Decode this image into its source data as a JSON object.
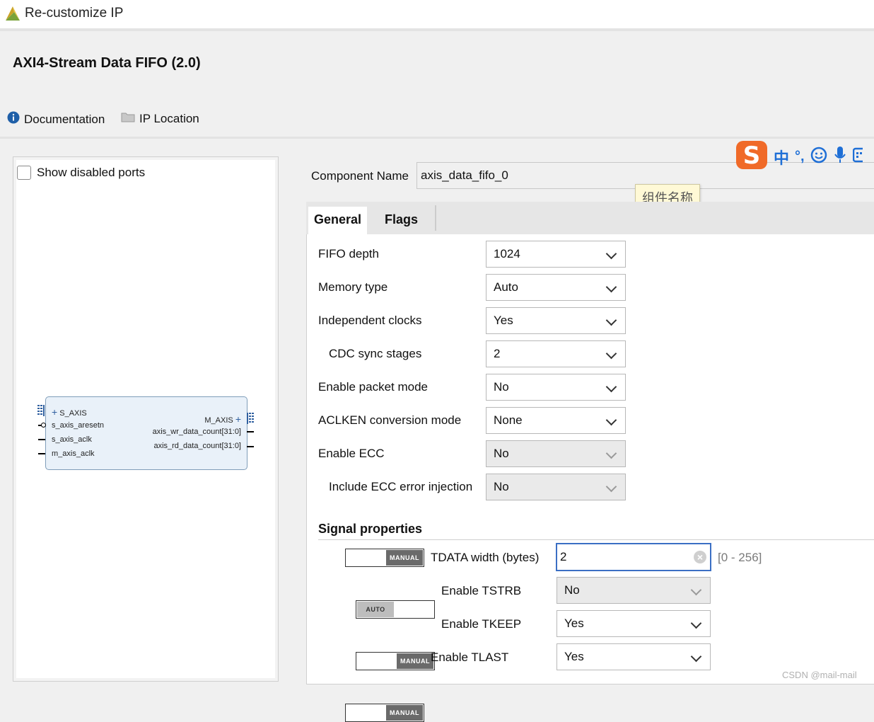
{
  "window": {
    "title": "Re-customize IP"
  },
  "ip": {
    "title": "AXI4-Stream Data FIFO (2.0)"
  },
  "toplinks": {
    "documentation": "Documentation",
    "ip_location": "IP Location"
  },
  "symbol": {
    "show_disabled_ports": "Show disabled ports",
    "left_ports": [
      "S_AXIS",
      "s_axis_aresetn",
      "s_axis_aclk",
      "m_axis_aclk"
    ],
    "right_ports": [
      "M_AXIS",
      "axis_wr_data_count[31:0]",
      "axis_rd_data_count[31:0]"
    ]
  },
  "component": {
    "label": "Component Name",
    "value": "axis_data_fifo_0"
  },
  "ime": {
    "tooltip": "组件名称",
    "lang": "中",
    "punct": "°,"
  },
  "tabs": [
    {
      "label": "General"
    },
    {
      "label": "Flags"
    }
  ],
  "general": {
    "params": [
      {
        "label": "FIFO depth",
        "value": "1024",
        "enabled": true
      },
      {
        "label": "Memory type",
        "value": "Auto",
        "enabled": true
      },
      {
        "label": "Independent clocks",
        "value": "Yes",
        "enabled": true
      },
      {
        "label": "CDC sync stages",
        "value": "2",
        "enabled": true
      },
      {
        "label": "Enable packet mode",
        "value": "No",
        "enabled": true
      },
      {
        "label": "ACLKEN conversion mode",
        "value": "None",
        "enabled": true
      },
      {
        "label": "Enable ECC",
        "value": "No",
        "enabled": false
      },
      {
        "label": "Include ECC error injection",
        "value": "No",
        "enabled": false
      }
    ],
    "signal_properties": {
      "title": "Signal properties",
      "tdata": {
        "mode": "MANUAL",
        "label": "TDATA width (bytes)",
        "value": "2",
        "range": "[0 - 256]"
      },
      "tstrb": {
        "mode": "AUTO",
        "label": "Enable TSTRB",
        "value": "No"
      },
      "tkeep": {
        "mode": "MANUAL",
        "label": "Enable TKEEP",
        "value": "Yes"
      },
      "tlast": {
        "mode": "MANUAL",
        "label": "Enable TLAST",
        "value": "Yes"
      }
    }
  },
  "watermark": "CSDN @mail-mail"
}
